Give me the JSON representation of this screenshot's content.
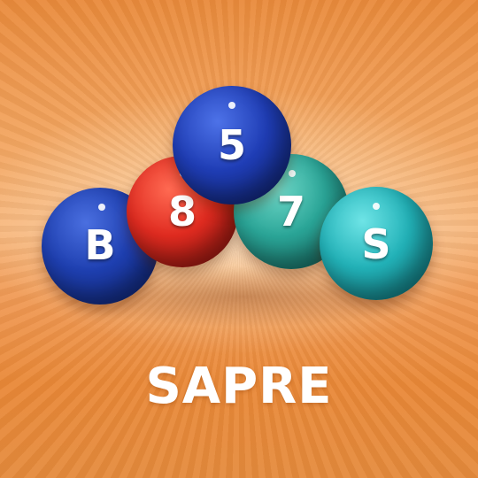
{
  "title": "SAPRE",
  "balls": [
    {
      "label": "B",
      "color": "#1e3fb0"
    },
    {
      "label": "8",
      "color": "#e02b20"
    },
    {
      "label": "5",
      "color": "#1f3db5"
    },
    {
      "label": "7",
      "color": "#2aa597"
    },
    {
      "label": "S",
      "color": "#22b2b8"
    }
  ],
  "background_color": "#f09a55"
}
